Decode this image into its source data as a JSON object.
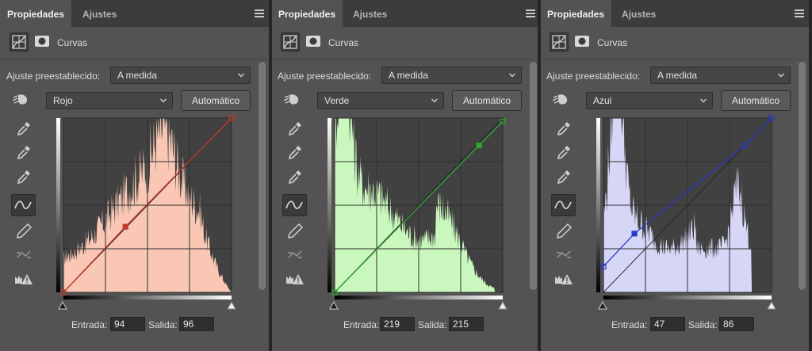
{
  "panels": [
    {
      "tab_active": "Propiedades",
      "tab_inactive": "Ajustes",
      "header_title": "Curvas",
      "preset_label": "Ajuste preestablecido:",
      "preset_value": "A medida",
      "channel_value": "Rojo",
      "auto_label": "Automático",
      "input_label": "Entrada:",
      "input_value": "94",
      "output_label": "Salida:",
      "output_value": "96",
      "channel_color": "#c23b2a",
      "histogram_fill": "#f9c7b4",
      "curve_points": [
        [
          0,
          0
        ],
        [
          94,
          96
        ],
        [
          255,
          255
        ]
      ]
    },
    {
      "tab_active": "Propiedades",
      "tab_inactive": "Ajustes",
      "header_title": "Curvas",
      "preset_label": "Ajuste preestablecido:",
      "preset_value": "A medida",
      "channel_value": "Verde",
      "auto_label": "Automático",
      "input_label": "Entrada:",
      "input_value": "219",
      "output_label": "Salida:",
      "output_value": "215",
      "channel_color": "#2fa52f",
      "histogram_fill": "#c9f7bd",
      "curve_points": [
        [
          0,
          0
        ],
        [
          219,
          215
        ],
        [
          255,
          250
        ]
      ]
    },
    {
      "tab_active": "Propiedades",
      "tab_inactive": "Ajustes",
      "header_title": "Curvas",
      "preset_label": "Ajuste preestablecido:",
      "preset_value": "A medida",
      "channel_value": "Azul",
      "auto_label": "Automático",
      "input_label": "Entrada:",
      "input_value": "47",
      "output_label": "Salida:",
      "output_value": "86",
      "channel_color": "#2b37c8",
      "histogram_fill": "#d6d6f7",
      "curve_points": [
        [
          0,
          38
        ],
        [
          47,
          86
        ],
        [
          215,
          215
        ],
        [
          255,
          255
        ]
      ]
    }
  ]
}
